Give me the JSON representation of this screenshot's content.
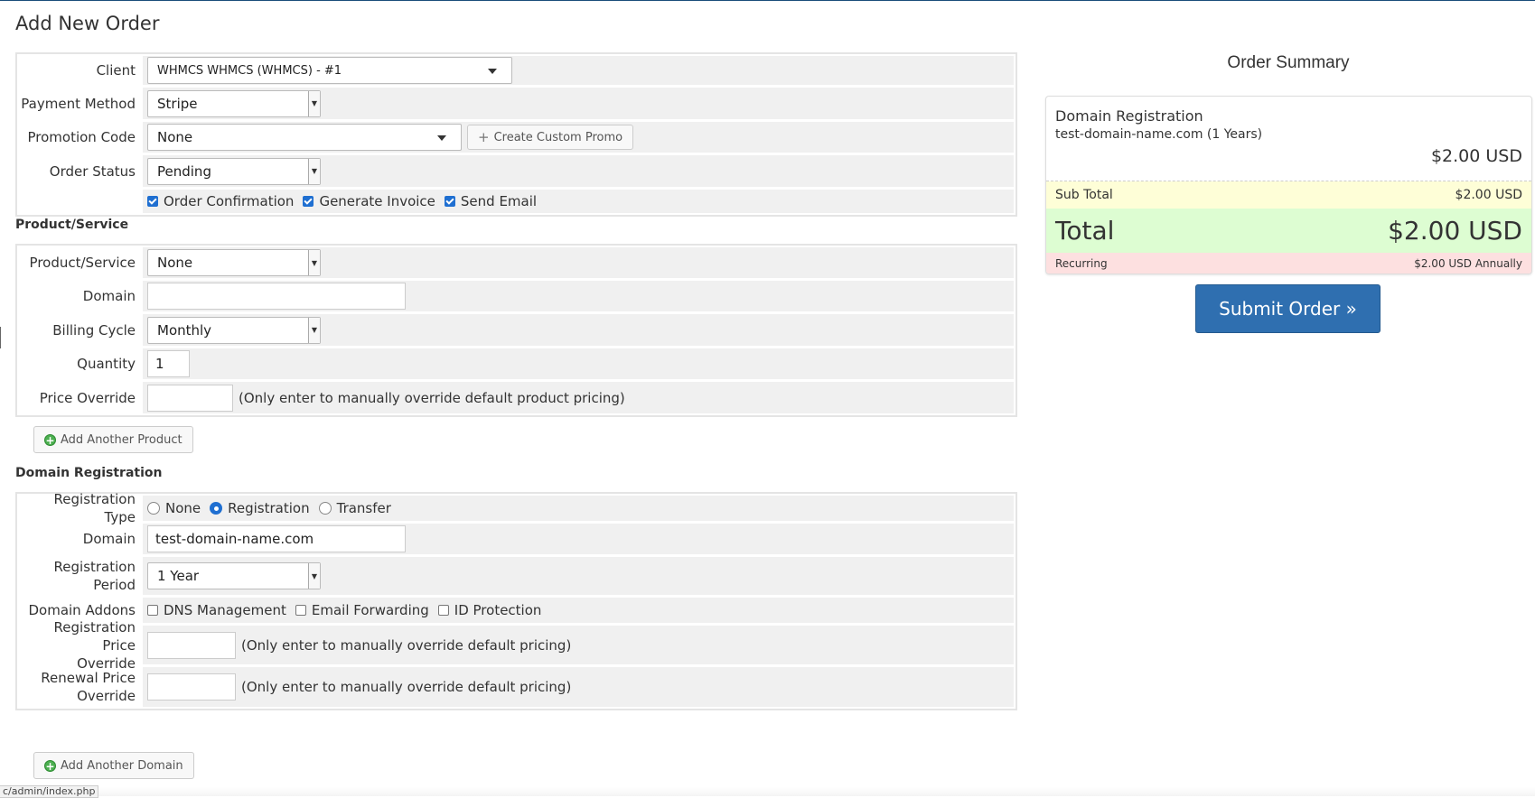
{
  "page": {
    "title": "Add New Order"
  },
  "order": {
    "client_label": "Client",
    "client_value": "WHMCS WHMCS (WHMCS) - #1",
    "payment_label": "Payment Method",
    "payment_value": "Stripe",
    "promo_label": "Promotion Code",
    "promo_value": "None",
    "create_promo_button": "Create Custom Promo",
    "status_label": "Order Status",
    "status_value": "Pending",
    "checkboxes": [
      {
        "label": "Order Confirmation",
        "checked": true
      },
      {
        "label": "Generate Invoice",
        "checked": true
      },
      {
        "label": "Send Email",
        "checked": true
      }
    ]
  },
  "product": {
    "section_title": "Product/Service",
    "product_label": "Product/Service",
    "product_value": "None",
    "domain_label": "Domain",
    "domain_value": "",
    "cycle_label": "Billing Cycle",
    "cycle_value": "Monthly",
    "quantity_label": "Quantity",
    "quantity_value": "1",
    "override_label": "Price Override",
    "override_value": "",
    "override_hint": "(Only enter to manually override default product pricing)",
    "add_button": "Add Another Product"
  },
  "domain": {
    "section_title": "Domain Registration",
    "reg_type_label": "Registration Type",
    "reg_type_options": [
      {
        "label": "None",
        "selected": false
      },
      {
        "label": "Registration",
        "selected": true
      },
      {
        "label": "Transfer",
        "selected": false
      }
    ],
    "domain_label": "Domain",
    "domain_value": "test-domain-name.com",
    "period_label_1": "Registration",
    "period_label_2": "Period",
    "period_value": "1 Year",
    "addons_label": "Domain Addons",
    "addons": [
      {
        "label": "DNS Management",
        "checked": false
      },
      {
        "label": "Email Forwarding",
        "checked": false
      },
      {
        "label": "ID Protection",
        "checked": false
      }
    ],
    "reg_price_label_1": "Registration Price",
    "reg_price_label_2": "Override",
    "reg_price_value": "",
    "reg_price_hint": "(Only enter to manually override default pricing)",
    "renew_price_label_1": "Renewal Price",
    "renew_price_label_2": "Override",
    "renew_price_value": "",
    "renew_price_hint": "(Only enter to manually override default pricing)",
    "add_button": "Add Another Domain"
  },
  "summary": {
    "title": "Order Summary",
    "item_name": "Domain Registration",
    "item_desc": "test-domain-name.com (1 Years)",
    "item_price": "$2.00 USD",
    "subtotal_label": "Sub Total",
    "subtotal_value": "$2.00 USD",
    "total_label": "Total",
    "total_value": "$2.00 USD",
    "recurring_label": "Recurring",
    "recurring_value": "$2.00 USD Annually",
    "submit_button": "Submit Order »"
  },
  "statusbar": {
    "url": "c/admin/index.php"
  },
  "colors": {
    "accent": "#2f6fb0",
    "subtotal_bg": "#fefed7",
    "total_bg": "#ddfdd2",
    "recurring_bg": "#fde0e0"
  }
}
